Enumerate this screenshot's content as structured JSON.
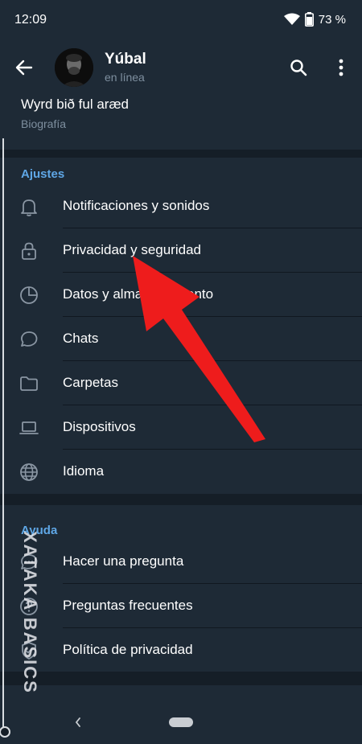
{
  "status_bar": {
    "time": "12:09",
    "battery": "73 %",
    "icons": [
      "wifi-icon",
      "battery-icon"
    ]
  },
  "header": {
    "back_icon": "arrow-left-icon",
    "profile_name": "Yúbal",
    "profile_status": "en línea",
    "search_icon": "search-icon",
    "menu_icon": "more-vertical-icon"
  },
  "bio": {
    "text": "Wyrd bið ful aræd",
    "label": "Biografía"
  },
  "settings": {
    "title": "Ajustes",
    "items": [
      {
        "label": "Notificaciones y sonidos",
        "icon": "bell-icon"
      },
      {
        "label": "Privacidad y seguridad",
        "icon": "lock-icon"
      },
      {
        "label": "Datos y almacenamiento",
        "icon": "pie-chart-icon"
      },
      {
        "label": "Chats",
        "icon": "chat-bubble-icon"
      },
      {
        "label": "Carpetas",
        "icon": "folder-icon"
      },
      {
        "label": "Dispositivos",
        "icon": "laptop-icon"
      },
      {
        "label": "Idioma",
        "icon": "globe-icon"
      }
    ]
  },
  "help": {
    "title": "Ayuda",
    "items": [
      {
        "label": "Hacer una pregunta",
        "icon": "chat-dots-icon"
      },
      {
        "label": "Preguntas frecuentes",
        "icon": "question-icon"
      },
      {
        "label": "Política de privacidad",
        "icon": "shield-icon"
      }
    ]
  },
  "watermark": "XATAKA BASICS",
  "colors": {
    "background": "#151e27",
    "surface": "#1e2a36",
    "accent": "#5fa7e6",
    "secondary_text": "#7e8f9f",
    "arrow": "#ee1c1c"
  }
}
